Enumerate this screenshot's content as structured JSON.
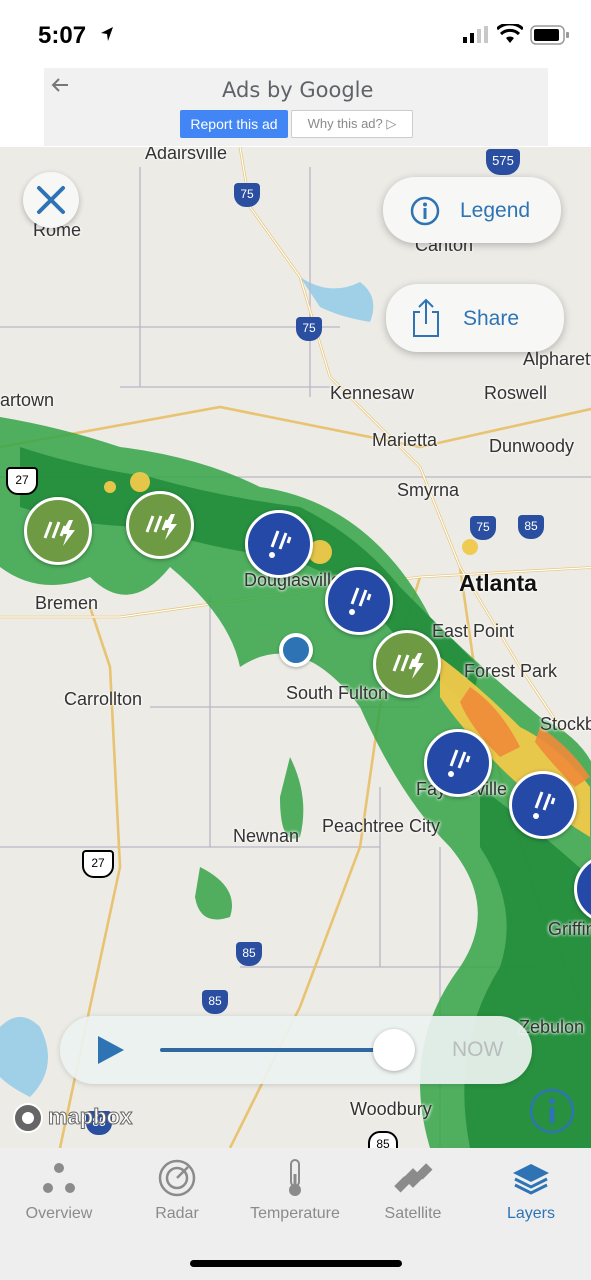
{
  "status_bar": {
    "time": "5:07"
  },
  "ad": {
    "title": "Ads by Google",
    "report_label": "Report this ad",
    "why_label": "Why this ad? ▷"
  },
  "map": {
    "places": [
      "Adairsville",
      "Rome",
      "Canton",
      "Alpharetta",
      "artown",
      "Kennesaw",
      "Roswell",
      "Marietta",
      "Dunwoody",
      "Smyrna",
      "Atlanta",
      "Douglasville",
      "Bremen",
      "East Point",
      "Forest Park",
      "South Fulton",
      "Carrollton",
      "Stockbridge",
      "Fayetteville",
      "Newnan",
      "Peachtree City",
      "Griffin",
      "Woodbury",
      "Zebulon"
    ],
    "highway_shields": [
      "575",
      "75",
      "75",
      "27",
      "75",
      "85",
      "27",
      "85",
      "85",
      "85",
      "85"
    ],
    "legend_label": "Legend",
    "share_label": "Share",
    "attribution": "mapbox"
  },
  "timeline": {
    "now_label": "NOW",
    "progress": 0.9
  },
  "tabs": [
    {
      "label": "Overview",
      "icon": "overview-dots-icon"
    },
    {
      "label": "Radar",
      "icon": "radar-icon"
    },
    {
      "label": "Temperature",
      "icon": "thermometer-icon"
    },
    {
      "label": "Satellite",
      "icon": "satellite-icon"
    },
    {
      "label": "Layers",
      "icon": "layers-icon",
      "active": true
    }
  ],
  "colors": {
    "accent": "#2e74b5",
    "storm_blue": "#2449a6",
    "storm_green": "#6e9a44",
    "radar_green": "#35a447"
  }
}
